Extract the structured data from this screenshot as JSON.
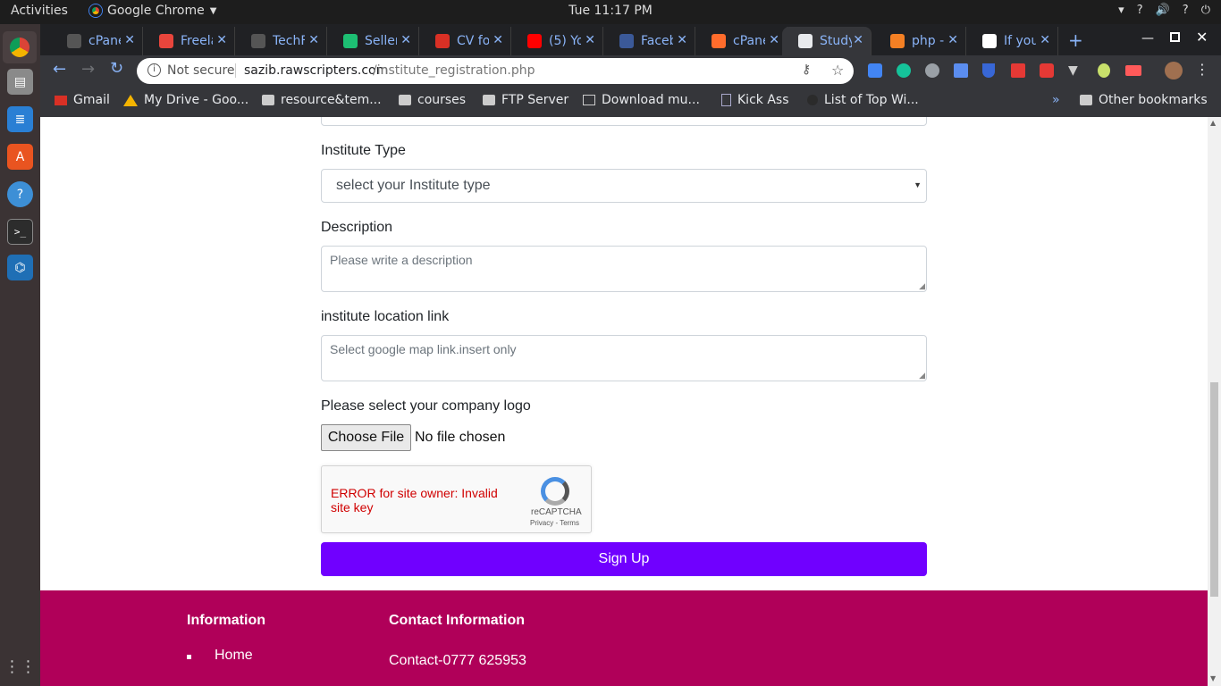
{
  "os": {
    "activities": "Activities",
    "app_name": "Google Chrome",
    "clock": "Tue 11:17 PM"
  },
  "tabs": [
    {
      "title": "cPane",
      "color": "#555"
    },
    {
      "title": "Freela",
      "color": "#e8453c"
    },
    {
      "title": "TechF",
      "color": "#555"
    },
    {
      "title": "Seller",
      "color": "#1dbf73"
    },
    {
      "title": "CV for",
      "color": "#d93025"
    },
    {
      "title": "(5) Yo",
      "color": "#ff0000"
    },
    {
      "title": "Faceb",
      "color": "#3b5998"
    },
    {
      "title": "cPane",
      "color": "#ff6c2c"
    },
    {
      "title": "Study",
      "color": "#e8eaed"
    },
    {
      "title": "php -",
      "color": "#f48024"
    },
    {
      "title": "If you",
      "color": "#fff"
    }
  ],
  "address": {
    "security": "Not secure",
    "domain": "sazib.rawscripters.com",
    "path": "/institute_registration.php"
  },
  "bookmarks": [
    "Gmail",
    "My Drive - Goo...",
    "resource&tem...",
    "courses",
    "FTP Server",
    "Download mu...",
    "Kick Ass",
    "List of Top Wi...",
    "Other bookmarks"
  ],
  "form": {
    "institute_type_label": "Institute Type",
    "institute_type_value": "select your Institute type",
    "description_label": "Description",
    "description_placeholder": "Please write a description",
    "location_label": "institute location link",
    "location_placeholder": "Select google map link.insert only",
    "logo_label": "Please select your company logo",
    "choose_file": "Choose File",
    "no_file": "No file chosen",
    "captcha_error": "ERROR for site owner: Invalid site key",
    "captcha_brand": "reCAPTCHA",
    "captcha_links": "Privacy - Terms",
    "signup": "Sign Up"
  },
  "footer": {
    "info_heading": "Information",
    "info_home": "Home",
    "contact_heading": "Contact Information",
    "contact_phone": "Contact-0777 625953"
  },
  "colors": {
    "signup_bg": "#7000ff",
    "footer_bg": "#b00059",
    "captcha_error": "#d00000"
  }
}
